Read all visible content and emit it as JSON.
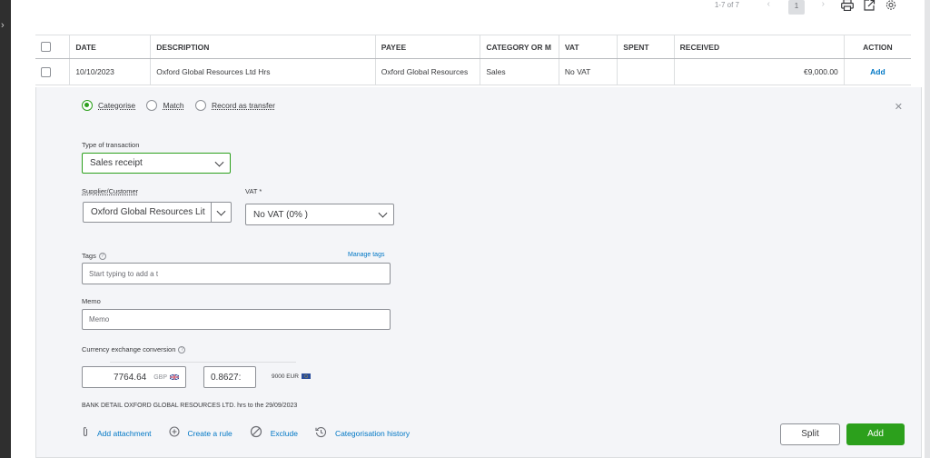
{
  "pager": {
    "range": "1-7 of 7",
    "current_page": "1"
  },
  "table": {
    "headers": [
      "DATE",
      "DESCRIPTION",
      "PAYEE",
      "CATEGORY OR M",
      "VAT",
      "SPENT",
      "RECEIVED",
      "ACTION"
    ],
    "row": {
      "date": "10/10/2023",
      "description": "Oxford Global Resources Ltd Hrs",
      "payee": "Oxford Global Resources",
      "category": "Sales",
      "vat": "No VAT",
      "spent": "",
      "received": "€9,000.00",
      "action": "Add"
    }
  },
  "panel": {
    "radios": [
      {
        "label": "Categorise",
        "checked": true
      },
      {
        "label": "Match",
        "checked": false
      },
      {
        "label": "Record as transfer",
        "checked": false
      }
    ],
    "type_label": "Type of transaction",
    "type_value": "Sales receipt",
    "supplier_label": "Supplier/Customer",
    "supplier_value": "Oxford Global Resources Lit",
    "vat_label": "VAT *",
    "vat_value": "No VAT (0% )",
    "tags_label": "Tags",
    "manage_tags": "Manage tags",
    "tags_placeholder": "Start typing to add a t",
    "memo_label": "Memo",
    "memo_placeholder": "Memo",
    "currency_label": "Currency exchange conversion",
    "amount_value": "7764.64",
    "amount_currency": "GBP",
    "rate_value": "0.8627:",
    "converted": "9000 EUR",
    "bank_detail": "BANK DETAIL OXFORD GLOBAL RESOURCES LTD. hrs to the 29/09/2023",
    "links": {
      "attachment": "Add attachment",
      "create_rule": "Create a rule",
      "exclude": "Exclude",
      "history": "Categorisation history"
    },
    "split_label": "Split",
    "add_label": "Add"
  },
  "colors": {
    "accent_green": "#2ca01c",
    "link_blue": "#0077c5"
  }
}
